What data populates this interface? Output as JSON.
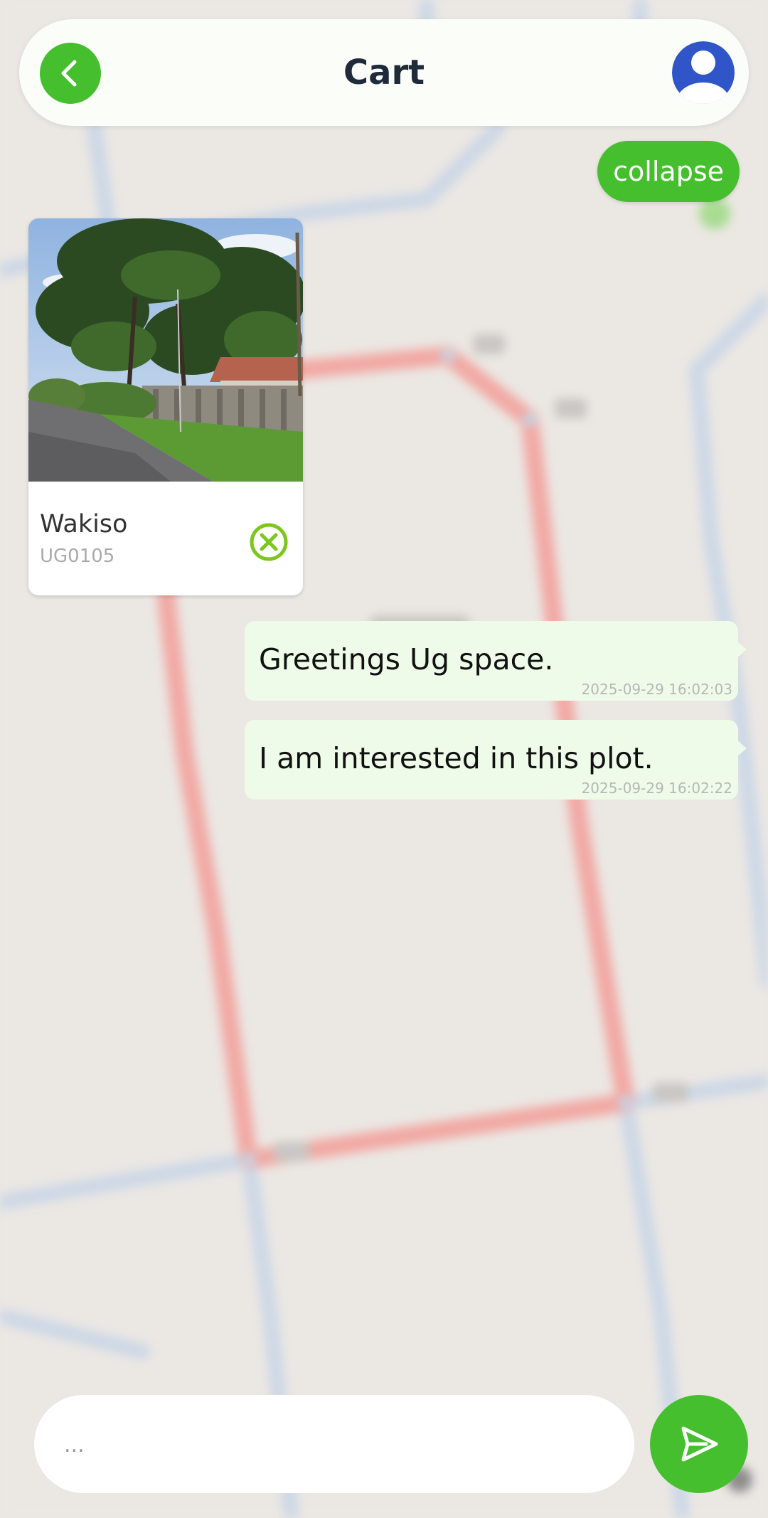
{
  "header": {
    "title": "Cart",
    "back_icon": "chevron-left-icon",
    "avatar_icon": "user-avatar-icon"
  },
  "collapse_label": "collapse",
  "property": {
    "name": "Wakiso",
    "code": "UG0105",
    "remove_icon": "remove-circle-icon"
  },
  "messages": [
    {
      "text": "Greetings Ug space.",
      "time": "2025-09-29 16:02:03"
    },
    {
      "text": "I am interested in this plot.",
      "time": "2025-09-29 16:02:22"
    }
  ],
  "composer": {
    "placeholder": "...",
    "send_icon": "send-icon"
  },
  "colors": {
    "accent": "#45bf2e",
    "title": "#1f2b3a",
    "bubble": "#eefbe9",
    "avatar": "#2f55c8",
    "remove": "#7cc71d"
  }
}
